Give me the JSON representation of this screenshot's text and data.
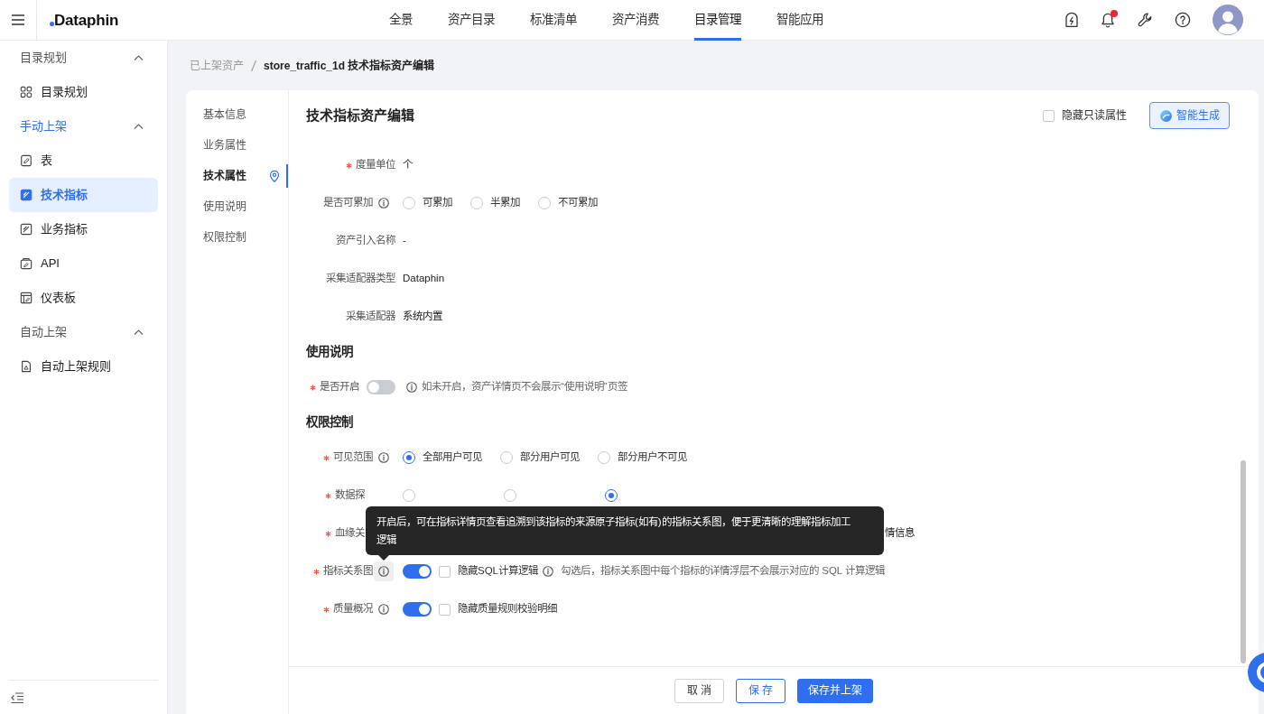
{
  "header": {
    "logo": "Dataphin",
    "nav": [
      {
        "label": "全景",
        "selected": false
      },
      {
        "label": "资产目录",
        "selected": false
      },
      {
        "label": "标准清单",
        "selected": false
      },
      {
        "label": "资产消费",
        "selected": false
      },
      {
        "label": "目录管理",
        "selected": true
      },
      {
        "label": "智能应用",
        "selected": false
      }
    ],
    "unread_notifications": true
  },
  "sidebar": {
    "groups": [
      {
        "label": "目录规划",
        "expanded": true,
        "items": [
          {
            "label": "目录规划",
            "kind": "grid",
            "selected": false
          }
        ]
      },
      {
        "label": "手动上架",
        "expanded": true,
        "items": [
          {
            "label": "表",
            "kind": "table",
            "selected": false
          },
          {
            "label": "技术指标",
            "kind": "metric",
            "selected": true
          },
          {
            "label": "业务指标",
            "kind": "metric",
            "selected": false
          },
          {
            "label": "API",
            "kind": "api",
            "selected": false
          },
          {
            "label": "仪表板",
            "kind": "dashboard",
            "selected": false
          }
        ]
      },
      {
        "label": "自动上架",
        "expanded": true,
        "items": [
          {
            "label": "自动上架规则",
            "kind": "rule",
            "selected": false
          }
        ]
      }
    ]
  },
  "breadcrumb": [
    "已上架资产",
    "store_traffic_1d 技术指标资产编辑"
  ],
  "anchor_nav": [
    {
      "label": "基本信息",
      "selected": false
    },
    {
      "label": "业务属性",
      "selected": false
    },
    {
      "label": "技术属性",
      "selected": true
    },
    {
      "label": "使用说明",
      "selected": false
    },
    {
      "label": "权限控制",
      "selected": false
    }
  ],
  "editor": {
    "title": "技术指标资产编辑",
    "hide_readonly": {
      "label": "隐藏只读属性",
      "checked": false
    },
    "ai_button": "智能生成"
  },
  "sections": [
    {
      "rows": [
        {
          "label": "度量单位",
          "required": true,
          "kind": "text",
          "value": "个"
        },
        {
          "label": "是否可累加",
          "info": true,
          "kind": "radio",
          "options": [
            {
              "label": "可累加",
              "selected": false
            },
            {
              "label": "半累加",
              "selected": false
            },
            {
              "label": "不可累加",
              "selected": false
            }
          ]
        },
        {
          "label": "资产引入名称",
          "kind": "text",
          "value": "-"
        },
        {
          "label": "采集适配器类型",
          "kind": "text",
          "value": "Dataphin"
        },
        {
          "label": "采集适配器",
          "kind": "text",
          "value": "系统内置"
        }
      ]
    },
    {
      "title": "使用说明",
      "rows": [
        {
          "label": "是否开启",
          "required": true,
          "kind": "toggle-note",
          "on": false,
          "note": "如未开启，资产详情页不会展示“使用说明”页签"
        }
      ]
    },
    {
      "title": "权限控制",
      "rows": [
        {
          "label": "可见范围",
          "required": true,
          "info": true,
          "kind": "radio",
          "options": [
            {
              "label": "全部用户可见",
              "selected": true
            },
            {
              "label": "部分用户可见",
              "selected": false
            },
            {
              "label": "部分用户不可见",
              "selected": false
            }
          ]
        },
        {
          "label": "数据探",
          "required": true,
          "kind": "radio-masked",
          "options": [
            {
              "selected": false
            },
            {
              "selected": false
            },
            {
              "selected": true
            }
          ]
        },
        {
          "label": "血缘关",
          "required": true,
          "kind": "text-masked",
          "tail": "情信息"
        },
        {
          "label": "指标关系图",
          "required": true,
          "info": true,
          "tooltip": "开启后，可在指标详情页查看追溯到该指标的来源原子指标(如有)的指标关系图，便于更清晰的理解指标加工逻辑",
          "kind": "toggle-check",
          "on": true,
          "checkbox": {
            "label": "隐藏SQL计算逻辑",
            "checked": false
          },
          "note": "勾选后，指标关系图中每个指标的详情浮层不会展示对应的 SQL 计算逻辑"
        },
        {
          "label": "质量概况",
          "required": true,
          "info": true,
          "kind": "toggle-check",
          "on": true,
          "checkbox": {
            "label": "隐藏质量规则校验明细",
            "checked": false
          }
        }
      ]
    }
  ],
  "footer": {
    "buttons": [
      {
        "label": "取 消",
        "kind": "default"
      },
      {
        "label": "保 存",
        "kind": "outline"
      },
      {
        "label": "保存并上架",
        "kind": "primary"
      }
    ]
  }
}
